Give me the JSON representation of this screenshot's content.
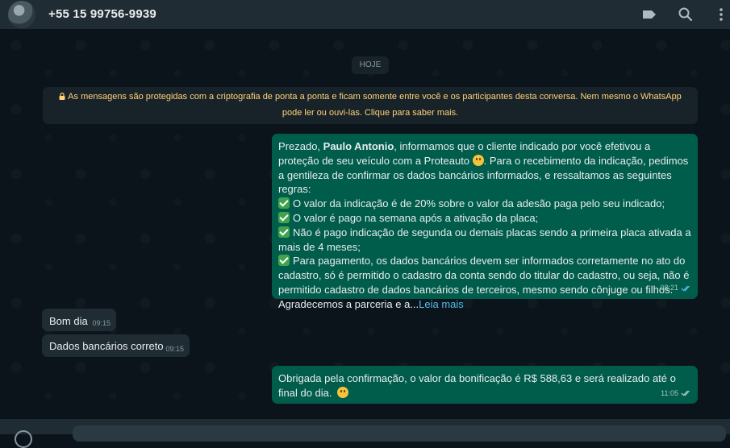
{
  "header": {
    "contact_name": "+55 15 99756-9939",
    "icons": [
      "avatar",
      "label-icon",
      "search-icon",
      "more-vertical-icon"
    ]
  },
  "chat": {
    "date_label": "HOJE",
    "system_message": {
      "line1": "As mensagens são protegidas com a criptografia de ponta a ponta e ficam somente entre você e os participantes desta conversa. Nem mesmo o WhatsApp",
      "line2": "pode ler ou ouvi-las. Clique para saber mais."
    },
    "messages": [
      {
        "direction": "out",
        "greeting": "Prezado, ",
        "name_bold": "Paulo Antonio",
        "intro_a": ", informamos que o cliente indicado por você efetivou a proteção de seu veículo com a Proteauto ",
        "intro_b": ". Para o recebimento da indicação, pedimos a gentileza de confirmar os dados bancários informados, e ressaltamos as seguintes regras:",
        "rules": [
          "O valor da indicação é de 20% sobre o valor da adesão paga pelo seu indicado;",
          "O valor é pago na semana após a ativação da placa;",
          "Não é pago indicação de segunda ou demais placas sendo a primeira placa ativada a mais de 4 meses;",
          "Para pagamento, os dados bancários devem ser informados corretamente no ato do cadastro, só é permitido o cadastro da conta sendo do titular do cadastro, ou seja, não é permitido cadastro de dados bancários de terceiros, mesmo sendo cônjuge ou filhos."
        ],
        "closing": "Agradecemos a parceria e a...",
        "read_more": "Leia mais",
        "time": "08:21"
      },
      {
        "direction": "in",
        "text": "Bom dia",
        "time": "09:15"
      },
      {
        "direction": "in",
        "text": "Dados bancários correto",
        "time": "09:15"
      },
      {
        "direction": "out",
        "text": "Obrigada pela confirmação, o valor da bonificação é R$ 588,63 e será realizado até o final do dia.",
        "time": "11:05"
      }
    ]
  },
  "colors": {
    "background": "#0b141a",
    "header": "#202c33",
    "bubble_out": "#005c4b",
    "bubble_in": "#202c33",
    "system_text": "#ffd279",
    "link": "#53bdeb"
  }
}
